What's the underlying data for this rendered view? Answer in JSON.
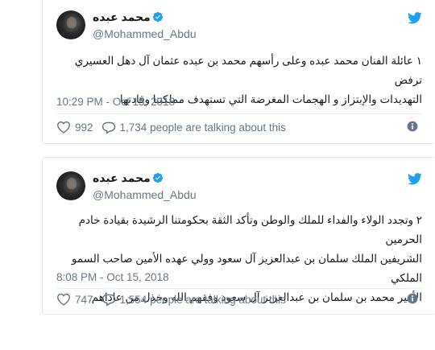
{
  "tweets": [
    {
      "author_name": "محمد عبده",
      "handle": "@Mohammed_Abdu",
      "text_lines": [
        "١ عائلة الفنان محمد عبده وعلى رأسهم محمد بن عبده عثمان آل دهل العسيري ترفض",
        "التهديدات والإبتزاز و الهجمات المغرضة التي تستهدف مملكتنا وقادتها"
      ],
      "timestamp": "10:29 PM - Oct 15, 2018",
      "likes": "992",
      "talking": "1,734 people are talking about this"
    },
    {
      "author_name": "محمد عبده",
      "handle": "@Mohammed_Abdu",
      "text_lines": [
        "٢ وتجدد الولاء والفداء للملك والوطن وتأكد الثقة بحكومتنا الرشيدة بقيادة خادم الحرمين",
        "الشريفين الملك سلمان بن عبدالعزيز آل سعود وولي عهده الأمين صاحب السمو الملكي",
        "الأمير محمد بن سلمان بن عبدالعزيز آل سعود وفقهم الله وخذل من عاداهم."
      ],
      "timestamp": "8:08 PM - Oct 15, 2018",
      "likes": "747",
      "talking": "1,554 people are talking about this"
    }
  ],
  "colors": {
    "twitter_blue": "#1da1f2",
    "secondary_text": "#657786",
    "border": "#e1e8ed"
  },
  "icons": [
    "twitter-bird-icon",
    "verified-badge-icon",
    "heart-icon",
    "comment-icon",
    "info-icon"
  ]
}
